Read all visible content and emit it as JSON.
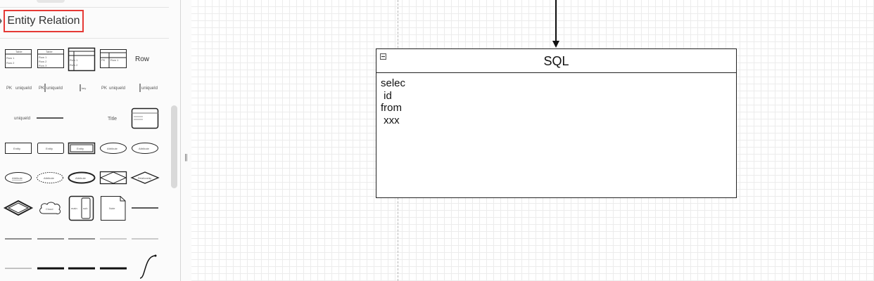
{
  "sidebar": {
    "section_title": "Entity Relation",
    "shape_labels": {
      "row": "Row",
      "pk": "PK",
      "unique_id": "uniqueId",
      "title": "Title",
      "entity": "Entity",
      "attribute": "Attribute",
      "relationship": "Relationship",
      "cloud": "Cloud",
      "note": "Note",
      "table": "Table",
      "row1": "Row 1",
      "row2": "Row 2",
      "row3": "Row 3",
      "main": "main",
      "sub": "sub"
    }
  },
  "canvas": {
    "table": {
      "title": "SQL",
      "body": "selec\n id\nfrom\n xxx"
    }
  },
  "colors": {
    "highlight_border": "#e53935",
    "grid_line": "#ececec",
    "shape_stroke": "#111111"
  }
}
